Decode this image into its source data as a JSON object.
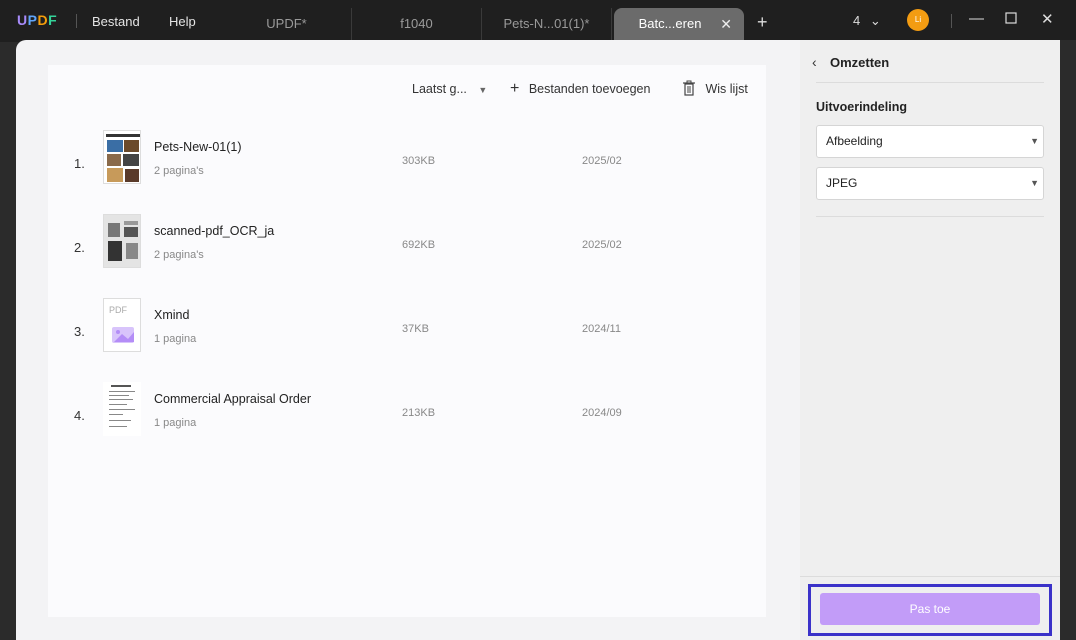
{
  "app": {
    "logo": "UPDF",
    "menu": [
      "Bestand",
      "Help"
    ]
  },
  "tabs": [
    {
      "label": "UPDF*"
    },
    {
      "label": "f1040"
    },
    {
      "label": "Pets-N...01(1)*"
    },
    {
      "label": "Batc...eren",
      "active": true
    }
  ],
  "window": {
    "count": "4",
    "avatar_initials": "Li"
  },
  "toolbar": {
    "sort_label": "Laatst g...",
    "add_label": "Bestanden toevoegen",
    "clear_label": "Wis lijst"
  },
  "files": [
    {
      "num": "1.",
      "name": "Pets-New-01(1)",
      "pages": "2 pagina's",
      "size": "303KB",
      "date": "2025/02"
    },
    {
      "num": "2.",
      "name": "scanned-pdf_OCR_ja",
      "pages": "2 pagina's",
      "size": "692KB",
      "date": "2025/02"
    },
    {
      "num": "3.",
      "name": "Xmind",
      "pages": "1 pagina",
      "size": "37KB",
      "date": "2024/11"
    },
    {
      "num": "4.",
      "name": "Commercial Appraisal Order",
      "pages": "1 pagina",
      "size": "213KB",
      "date": "2024/09"
    }
  ],
  "side": {
    "title": "Omzetten",
    "output_label": "Uitvoerindeling",
    "format_value": "Afbeelding",
    "subformat_value": "JPEG",
    "apply_label": "Pas toe"
  },
  "colors": {
    "accent": "#c29cf8",
    "highlight_border": "#3b32c9",
    "avatar": "#f39c12"
  }
}
